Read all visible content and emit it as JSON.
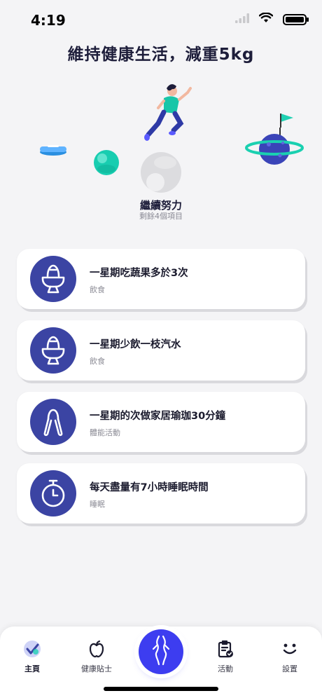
{
  "status_bar": {
    "time": "4:19"
  },
  "header": {
    "title": "維持健康生活，減重5kg"
  },
  "progress": {
    "title": "繼續努力",
    "subtitle": "剩餘4個項目"
  },
  "tasks": [
    {
      "title": "一星期吃蔬果多於3次",
      "category": "飲食",
      "icon": "egg-cup-icon"
    },
    {
      "title": "一星期少飲一枝汽水",
      "category": "飲食",
      "icon": "egg-cup-icon"
    },
    {
      "title": "一星期的次做家居瑜珈30分鐘",
      "category": "體能活動",
      "icon": "hand-grip-icon"
    },
    {
      "title": "每天盡量有7小時睡眠時間",
      "category": "睡眠",
      "icon": "stopwatch-icon"
    }
  ],
  "tab_bar": {
    "items": [
      {
        "label": "主頁",
        "icon": "home-check-icon",
        "active": true
      },
      {
        "label": "健康貼士",
        "icon": "apple-icon",
        "active": false
      },
      {
        "label": "活動",
        "icon": "clipboard-check-icon",
        "active": false
      },
      {
        "label": "設置",
        "icon": "smiley-icon",
        "active": false
      }
    ],
    "center_icon": "body-silhouette-icon"
  },
  "colors": {
    "accent": "#3d3df0",
    "icon_bg": "#3b44a3",
    "teal": "#1fd1b5",
    "background": "#f4f4f6"
  }
}
